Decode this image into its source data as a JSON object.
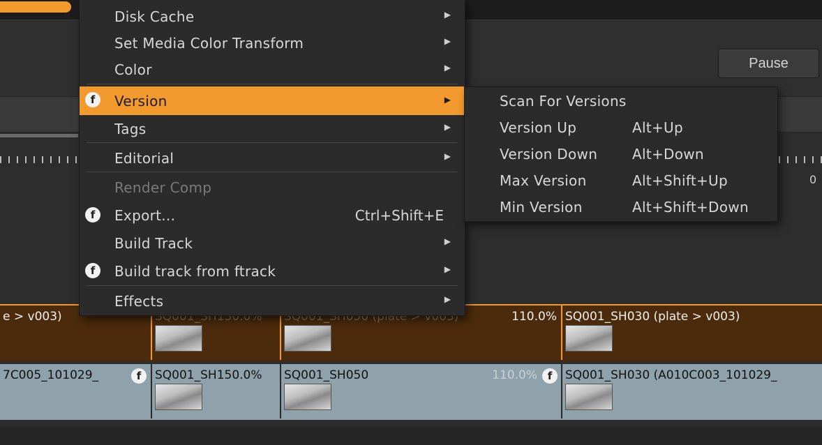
{
  "toolbar": {
    "pause_label": "Pause"
  },
  "ruler": {
    "zero_label": "0"
  },
  "tracks": {
    "top": [
      {
        "label": "e > v003)",
        "pct": ""
      },
      {
        "label": "SQ001_SH150.0%",
        "pct": ""
      },
      {
        "label": "SQ001_SH050 (plate > v003)",
        "pct": "110.0%"
      },
      {
        "label": "SQ001_SH030 (plate > v003)",
        "pct": ""
      }
    ],
    "bottom": [
      {
        "label": "7C005_101029_",
        "pct": ""
      },
      {
        "label": "SQ001_SH150.0%",
        "pct": ""
      },
      {
        "label": "SQ001_SH050",
        "pct": "110.0%"
      },
      {
        "label": "SQ001_SH030 (A010C003_101029_",
        "pct": ""
      }
    ],
    "badge_letter": "f"
  },
  "menu": {
    "items": [
      {
        "label": "Disk Cache",
        "arrow": "▶"
      },
      {
        "label": "Set Media Color Transform",
        "arrow": "▶"
      },
      {
        "label": "Color",
        "arrow": "▶"
      },
      {
        "label": "Version",
        "arrow": "▶",
        "icon": "f"
      },
      {
        "label": "Tags",
        "arrow": "▶"
      },
      {
        "label": "Editorial",
        "arrow": "▶"
      },
      {
        "label": "Render Comp"
      },
      {
        "label": "Export...",
        "shortcut": "Ctrl+Shift+E",
        "icon": "f"
      },
      {
        "label": "Build Track",
        "arrow": "▶"
      },
      {
        "label": "Build track from ftrack",
        "arrow": "▶",
        "icon": "f"
      },
      {
        "label": "Effects",
        "arrow": "▶"
      }
    ]
  },
  "submenu": {
    "items": [
      {
        "label": "Scan For Versions",
        "shortcut": ""
      },
      {
        "label": "Version Up",
        "shortcut": "Alt+Up"
      },
      {
        "label": "Version Down",
        "shortcut": "Alt+Down"
      },
      {
        "label": "Max Version",
        "shortcut": "Alt+Shift+Up"
      },
      {
        "label": "Min Version",
        "shortcut": "Alt+Shift+Down"
      }
    ]
  }
}
